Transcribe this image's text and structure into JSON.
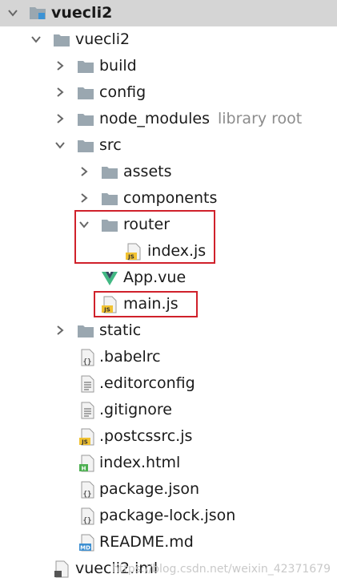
{
  "tree": {
    "items": [
      {
        "label": "vuecli2",
        "icon": "module-folder-icon",
        "expanded": true,
        "selected": true
      },
      {
        "label": "vuecli2",
        "icon": "folder-icon",
        "expanded": true
      },
      {
        "label": "build",
        "icon": "folder-icon",
        "expanded": false
      },
      {
        "label": "config",
        "icon": "folder-icon",
        "expanded": false
      },
      {
        "label": "node_modules",
        "icon": "folder-icon",
        "expanded": false,
        "tag": "library root"
      },
      {
        "label": "src",
        "icon": "folder-icon",
        "expanded": true
      },
      {
        "label": "assets",
        "icon": "folder-icon",
        "expanded": false
      },
      {
        "label": "components",
        "icon": "folder-icon",
        "expanded": false
      },
      {
        "label": "router",
        "icon": "folder-icon",
        "expanded": true,
        "highlighted": true
      },
      {
        "label": "index.js",
        "icon": "js-file-icon",
        "highlighted": true
      },
      {
        "label": "App.vue",
        "icon": "vue-file-icon"
      },
      {
        "label": "main.js",
        "icon": "js-file-icon",
        "highlighted": true
      },
      {
        "label": "static",
        "icon": "folder-icon",
        "expanded": false
      },
      {
        "label": ".babelrc",
        "icon": "json-file-icon"
      },
      {
        "label": ".editorconfig",
        "icon": "text-file-icon"
      },
      {
        "label": ".gitignore",
        "icon": "text-file-icon"
      },
      {
        "label": ".postcssrc.js",
        "icon": "js-file-icon"
      },
      {
        "label": "index.html",
        "icon": "html-file-icon"
      },
      {
        "label": "package.json",
        "icon": "json-file-icon"
      },
      {
        "label": "package-lock.json",
        "icon": "json-file-icon"
      },
      {
        "label": "README.md",
        "icon": "markdown-file-icon"
      },
      {
        "label": "vuecli2.iml",
        "icon": "iml-file-icon"
      }
    ]
  },
  "icon_badges": {
    "js": "JS",
    "md": "MD",
    "html": "H",
    "json": "{}"
  },
  "colors": {
    "selection": "#d5d5d5",
    "highlight_box": "#d0212b",
    "folder": "#9aa7b0",
    "js_badge": "#f1c232",
    "vue_green": "#41b883",
    "vue_dark": "#35495e",
    "html_badge": "#4caf50",
    "md_badge": "#3d8fd1",
    "secondary_text": "#8c8c8c"
  },
  "watermark": "https://blog.csdn.net/weixin_42371679"
}
